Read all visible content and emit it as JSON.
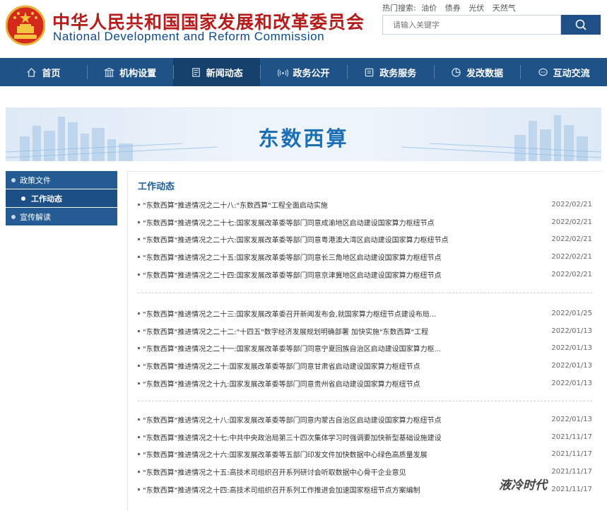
{
  "header": {
    "title_cn": "中华人民共和国国家发展和改革委员会",
    "title_en": "National Development and Reform Commission",
    "hot_label": "热门搜索:",
    "hot_terms": [
      "油价",
      "债券",
      "光伏",
      "天然气"
    ],
    "search_placeholder": "请输入关键字"
  },
  "nav": {
    "items": [
      {
        "label": "首页",
        "icon": "home-icon"
      },
      {
        "label": "机构设置",
        "icon": "building-icon"
      },
      {
        "label": "新闻动态",
        "icon": "news-icon",
        "active": true
      },
      {
        "label": "政务公开",
        "icon": "broadcast-icon"
      },
      {
        "label": "政务服务",
        "icon": "service-icon"
      },
      {
        "label": "发改数据",
        "icon": "pie-chart-icon"
      },
      {
        "label": "互动交流",
        "icon": "chat-icon"
      }
    ]
  },
  "banner": {
    "title": "东数西算"
  },
  "sidebar": {
    "items": [
      {
        "label": "政策文件"
      },
      {
        "label": "工作动态",
        "active": true
      },
      {
        "label": "宣传解读"
      }
    ]
  },
  "content": {
    "title": "工作动态",
    "groups": [
      [
        {
          "text": "\"东数西算\"推进情况之二十八:\"东数西算\"工程全面启动实施",
          "date": "2022/02/21"
        },
        {
          "text": "\"东数西算\"推进情况之二十七:国家发展改革委等部门同意成渝地区启动建设国家算力枢纽节点",
          "date": "2022/02/21"
        },
        {
          "text": "\"东数西算\"推进情况之二十六:国家发展改革委等部门同意粤港澳大湾区启动建设国家算力枢纽节点",
          "date": "2022/02/21"
        },
        {
          "text": "\"东数西算\"推进情况之二十五:国家发展改革委等部门同意长三角地区启动建设国家算力枢纽节点",
          "date": "2022/02/21"
        },
        {
          "text": "\"东数西算\"推进情况之二十四:国家发展改革委等部门同意京津冀地区启动建设国家算力枢纽节点",
          "date": "2022/02/21"
        }
      ],
      [
        {
          "text": "\"东数西算\"推进情况之二十三:国家发展改革委召开新闻发布会,就国家算力枢纽节点建设布局...",
          "date": "2022/01/25"
        },
        {
          "text": "\"东数西算\"推进情况之二十二:\"十四五\"数字经济发展规划明确部署 加快实施\"东数西算\"工程",
          "date": "2022/01/13"
        },
        {
          "text": "\"东数西算\"推进情况之二十一:国家发展改革委等部门同意宁夏回族自治区启动建设国家算力枢...",
          "date": "2022/01/13"
        },
        {
          "text": "\"东数西算\"推进情况之二十:国家发展改革委等部门同意甘肃省启动建设国家算力枢纽节点",
          "date": "2022/01/13"
        },
        {
          "text": "\"东数西算\"推进情况之十九:国家发展改革委等部门同意贵州省启动建设国家算力枢纽节点",
          "date": "2022/01/13"
        }
      ],
      [
        {
          "text": "\"东数西算\"推进情况之十八:国家发展改革委等部门同意内蒙古自治区启动建设国家算力枢纽节点",
          "date": "2022/01/13"
        },
        {
          "text": "\"东数西算\"推进情况之十七:中共中央政治局第三十四次集体学习时强调要加快新型基础设施建设",
          "date": "2021/11/17"
        },
        {
          "text": "\"东数西算\"推进情况之十六:国家发展改革委等五部门印发文件加快数据中心绿色高质量发展",
          "date": "2021/11/17"
        },
        {
          "text": "\"东数西算\"推进情况之十五:高技术司组织召开系列研讨会听取数据中心骨干企业意见",
          "date": "2021/11/17"
        },
        {
          "text": "\"东数西算\"推进情况之十四:高技术司组织召开系列工作推进会加速国家枢纽节点方案编制",
          "date": "2021/11/17"
        }
      ]
    ]
  },
  "watermark": {
    "text": "液冷时代"
  },
  "colors": {
    "nav_bg": "#1f5286",
    "title_red": "#b51c1c",
    "accent_blue": "#1d5d97"
  }
}
